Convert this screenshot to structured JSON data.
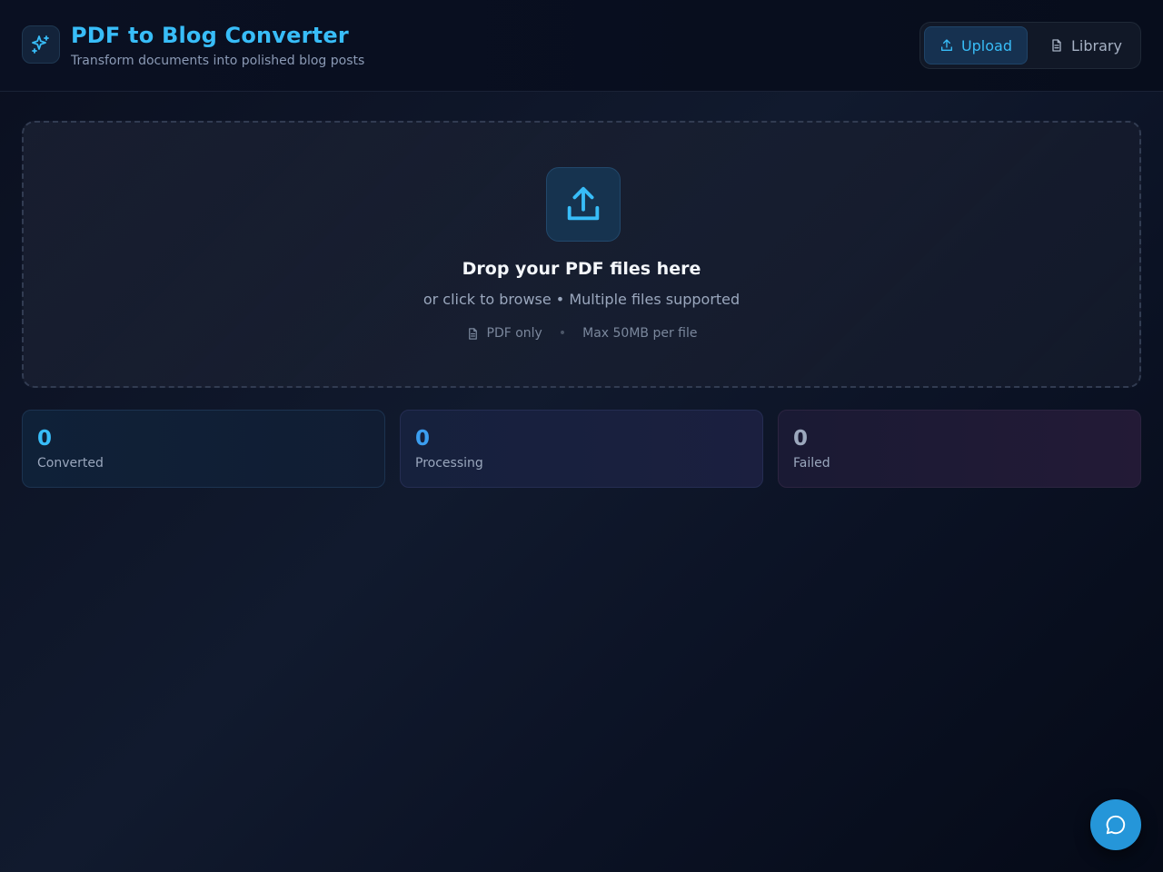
{
  "header": {
    "title": "PDF to Blog Converter",
    "subtitle": "Transform documents into polished blog posts",
    "logo_icon": "sparkles-icon"
  },
  "nav": {
    "upload_label": "Upload",
    "library_label": "Library",
    "active": "upload"
  },
  "dropzone": {
    "title": "Drop your PDF files here",
    "subtitle": "or click to browse • Multiple files supported",
    "format_label": "PDF only",
    "separator": "•",
    "size_label": "Max 50MB per file"
  },
  "stats": {
    "converted": {
      "value": "0",
      "label": "Converted"
    },
    "processing": {
      "value": "0",
      "label": "Processing"
    },
    "failed": {
      "value": "0",
      "label": "Failed"
    }
  },
  "colors": {
    "accent": "#38bdf8",
    "fab": "#2596d9",
    "background": "#0d1424"
  }
}
